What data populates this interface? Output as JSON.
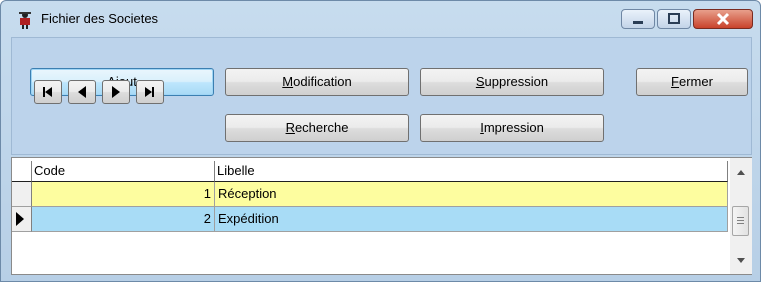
{
  "window": {
    "title": "Fichier des Societes"
  },
  "toolbar": {
    "ajout": {
      "accel": "A",
      "rest": "jout"
    },
    "modification": {
      "accel": "M",
      "rest": "odification"
    },
    "suppression": {
      "accel": "S",
      "rest": "uppression"
    },
    "fermer": {
      "accel": "F",
      "rest": "ermer"
    },
    "recherche": {
      "accel": "R",
      "rest": "echerche"
    },
    "impression": {
      "accel": "I",
      "rest": "mpression"
    }
  },
  "grid": {
    "columns": [
      "Code",
      "Libelle"
    ],
    "rows": [
      {
        "code": "1",
        "libelle": "Réception"
      },
      {
        "code": "2",
        "libelle": "Expédition"
      }
    ]
  },
  "colors": {
    "row1_bg": "#fdfd9f",
    "row2_bg": "#a8dcf6",
    "close_button": "#c9432c"
  },
  "icons": [
    "app-icon",
    "minimize-icon",
    "maximize-icon",
    "close-icon",
    "first-record-icon",
    "previous-record-icon",
    "next-record-icon",
    "last-record-icon",
    "current-row-pointer-icon",
    "scroll-up-icon",
    "scroll-down-icon"
  ]
}
